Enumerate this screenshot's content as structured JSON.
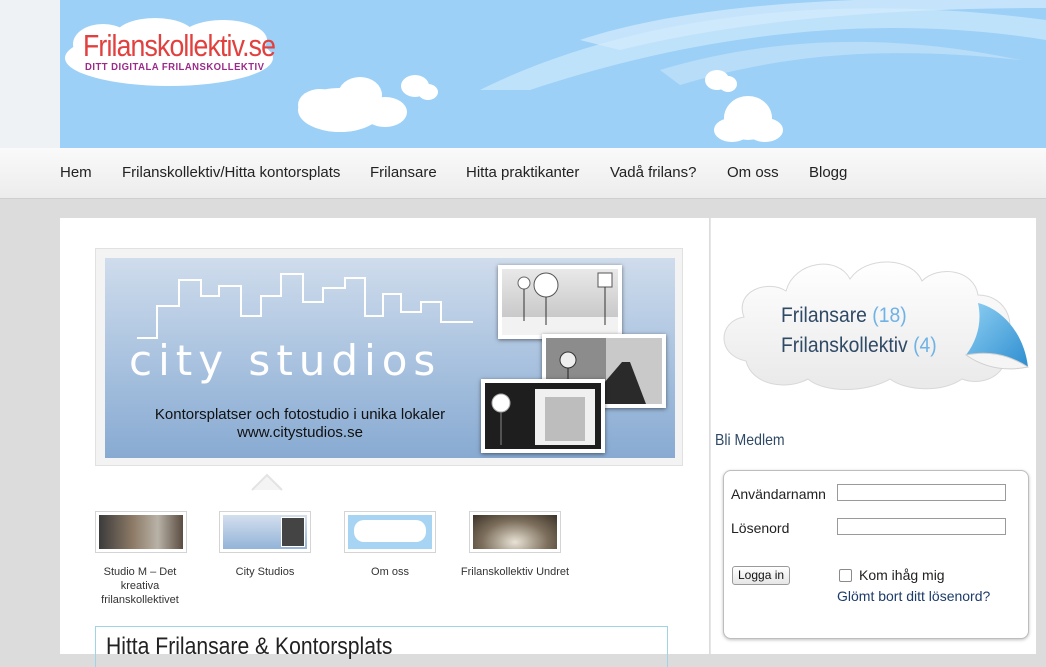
{
  "logo": {
    "title": "Frilanskollektiv.se",
    "tagline": "DITT DIGITALA FRILANSKOLLEKTIV"
  },
  "nav": {
    "items": [
      "Hem",
      "Frilanskollektiv/Hitta kontorsplats",
      "Frilansare",
      "Hitta praktikanter",
      "Vadå frilans?",
      "Om oss",
      "Blogg"
    ]
  },
  "banner": {
    "brand": "city studios",
    "line1": "Kontorsplatser och fotostudio i unika lokaler",
    "line2": "www.citystudios.se"
  },
  "thumbs": [
    {
      "label": "Studio M – Det kreativa frilanskollektivet"
    },
    {
      "label": "City Studios"
    },
    {
      "label": "Om oss"
    },
    {
      "label": "Frilanskollektiv Undret"
    }
  ],
  "search": {
    "title": "Hitta Frilansare & Kontorsplats"
  },
  "counts": {
    "frilansare_label": "Frilansare",
    "frilansare_count": "(18)",
    "kollektiv_label": "Frilanskollektiv",
    "kollektiv_count": "(4)"
  },
  "member": {
    "heading": "Bli Medlem"
  },
  "login": {
    "username_label": "Användarnamn",
    "password_label": "Lösenord",
    "username_value": "",
    "password_value": "",
    "button": "Logga in",
    "remember": "Kom ihåg mig",
    "forgot": "Glömt bort ditt lösenord?"
  },
  "colors": {
    "sky": "#9dd0f7",
    "logo_red": "#e2403e",
    "logo_purple": "#9b2a8a",
    "count_blue": "#6fb2e6",
    "heading_navy": "#2f4a66"
  }
}
